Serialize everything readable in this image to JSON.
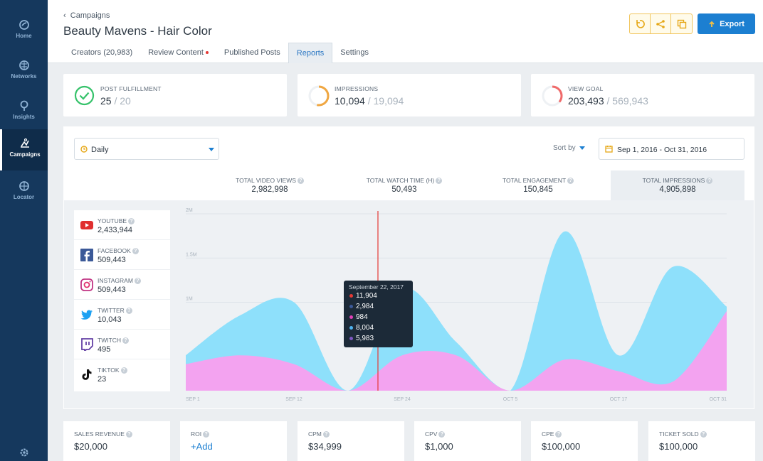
{
  "sidebar": {
    "items": [
      {
        "label": "Home",
        "icon": "home-icon"
      },
      {
        "label": "Networks",
        "icon": "networks-icon"
      },
      {
        "label": "Insights",
        "icon": "insights-icon"
      },
      {
        "label": "Campaigns",
        "icon": "campaigns-icon"
      },
      {
        "label": "Locator",
        "icon": "locator-icon"
      }
    ],
    "active": "Campaigns"
  },
  "header": {
    "breadcrumb": "Campaigns",
    "title": "Beauty Mavens - Hair Color",
    "tabs": [
      "Creators (20,983)",
      "Review Content",
      "Published Posts",
      "Reports",
      "Settings"
    ],
    "active_tab": "Reports",
    "export_label": "Export"
  },
  "stats": {
    "post_fulfillment": {
      "label": "POST FULFILLMENT",
      "value": "25",
      "total": " / 20"
    },
    "impressions": {
      "label": "IMPRESSIONS",
      "value": "10,094",
      "total": " / 19,094",
      "progress": 0.53
    },
    "view_goal": {
      "label": "VIEW GOAL",
      "value": "203,493",
      "total": " / 569,943",
      "progress": 0.36
    }
  },
  "filters": {
    "interval": "Daily",
    "sort_label": "Sort by",
    "date_range": "Sep 1, 2016 - Oct 31, 2016"
  },
  "metrics": [
    {
      "label": "TOTAL VIDEO VIEWS",
      "value": "2,982,998"
    },
    {
      "label": "TOTAL WATCH TIME (H)",
      "value": "50,493"
    },
    {
      "label": "TOTAL ENGAGEMENT",
      "value": "150,845"
    },
    {
      "label": "TOTAL IMPRESSIONS",
      "value": "4,905,898"
    }
  ],
  "platforms": [
    {
      "name": "YOUTUBE",
      "value": "2,433,944",
      "icon": "youtube-icon"
    },
    {
      "name": "FACEBOOK",
      "value": "509,443",
      "icon": "facebook-icon"
    },
    {
      "name": "INSTAGRAM",
      "value": "509,443",
      "icon": "instagram-icon"
    },
    {
      "name": "TWITTER",
      "value": "10,043",
      "icon": "twitter-icon"
    },
    {
      "name": "TWITCH",
      "value": "495",
      "icon": "twitch-icon"
    },
    {
      "name": "TIKTOK",
      "value": "23",
      "icon": "tiktok-icon"
    }
  ],
  "tooltip": {
    "date": "September 22, 2017",
    "rows": [
      {
        "value": "11,904",
        "color": "#e53935"
      },
      {
        "value": "2,984",
        "color": "#3b5998"
      },
      {
        "value": "984",
        "color": "#e040b8"
      },
      {
        "value": "8,004",
        "color": "#4fb3f0"
      },
      {
        "value": "5,983",
        "color": "#7e57c2"
      }
    ]
  },
  "chart_data": {
    "type": "area",
    "y_tick_labels": [
      "2M",
      "1.5M",
      "1M"
    ],
    "x_tick_labels": [
      "SEP 1",
      "SEP 12",
      "SEP 24",
      "OCT 5",
      "OCT 17",
      "OCT 31"
    ],
    "ylim": [
      0,
      2000000
    ],
    "x": [
      0,
      6,
      12,
      18,
      24,
      30,
      36,
      42,
      48,
      54,
      60
    ],
    "series": [
      {
        "color": "#8ee0fb",
        "values": [
          400000,
          850000,
          1000000,
          0,
          1150000,
          550000,
          0,
          1800000,
          400000,
          1400000,
          950000
        ]
      },
      {
        "color": "#f3a3f0",
        "values": [
          300000,
          400000,
          300000,
          0,
          400000,
          400000,
          0,
          350000,
          220000,
          100000,
          900000
        ]
      }
    ],
    "grid": true
  },
  "bottom_stats": [
    {
      "label": "SALES REVENUE",
      "value": "$20,000"
    },
    {
      "label": "ROI",
      "value": "+Add"
    },
    {
      "label": "CPM",
      "value": "$34,999"
    },
    {
      "label": "CPV",
      "value": "$1,000"
    },
    {
      "label": "CPE",
      "value": "$100,000"
    },
    {
      "label": "TICKET SOLD",
      "value": "$100,000"
    }
  ]
}
